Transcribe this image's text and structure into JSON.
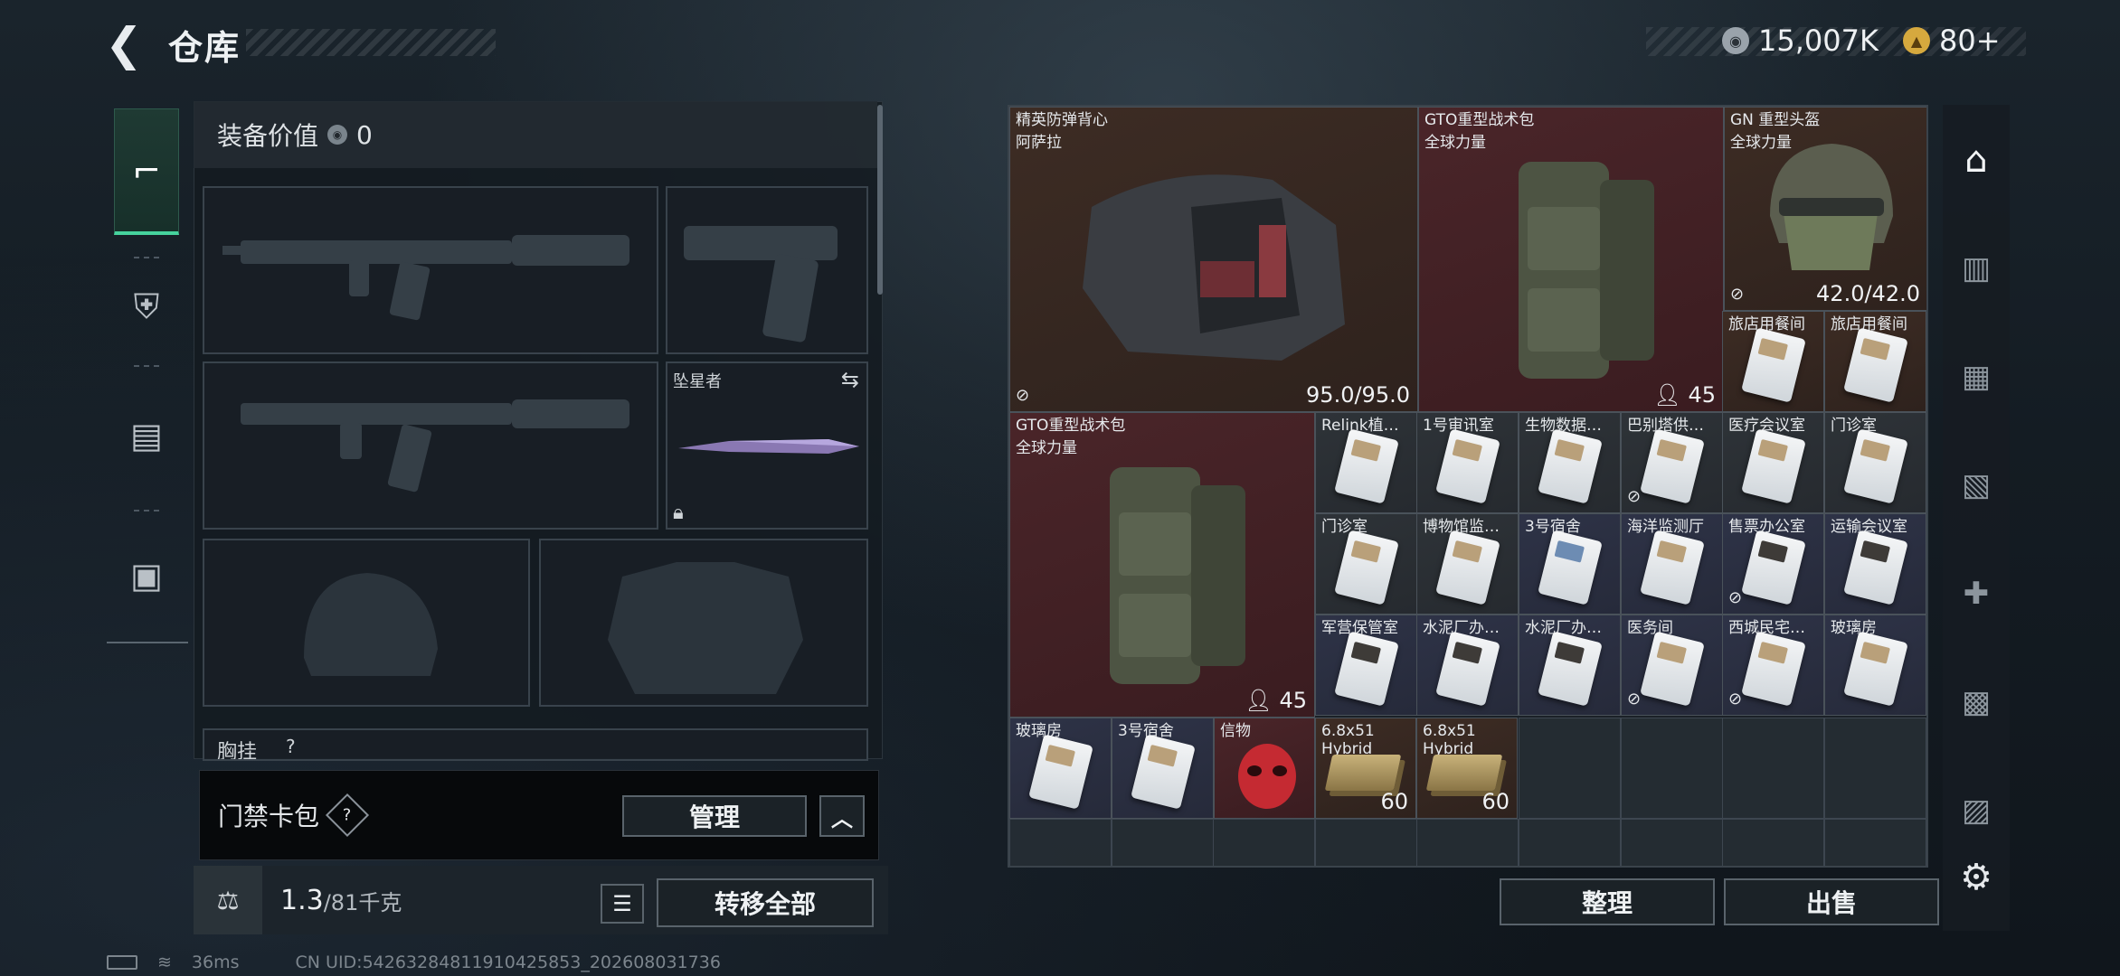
{
  "header": {
    "title": "仓库",
    "currency1": "15,007K",
    "currency2": "80+"
  },
  "left_tabs": [
    {
      "name": "weapon"
    },
    {
      "name": "armor"
    },
    {
      "name": "backpack"
    },
    {
      "name": "toolbox"
    }
  ],
  "equipment": {
    "value_label": "装备价值",
    "value": "0",
    "melee_name": "坠星者",
    "chest_label": "胸挂",
    "chest_hint": "?"
  },
  "card_bag": {
    "label": "门禁卡包",
    "help": "?",
    "manage": "管理"
  },
  "weight": {
    "current": "1.3",
    "max": "/81千克",
    "transfer_all": "转移全部"
  },
  "inventory": {
    "vest": {
      "name": "精英防弹背心",
      "sub": "阿萨拉",
      "value": "95.0/95.0"
    },
    "bag1": {
      "name": "GTO重型战术包",
      "sub": "全球力量",
      "value": "45"
    },
    "helmet": {
      "name": "GN 重型头盔",
      "sub": "全球力量",
      "value": "42.0/42.0"
    },
    "bag2": {
      "name": "GTO重型战术包",
      "sub": "全球力量",
      "value": "45"
    },
    "cards": [
      "旅店用餐间",
      "旅店用餐间",
      "Relink植…",
      "1号审讯室",
      "生物数据…",
      "巴别塔供…",
      "医疗会议室",
      "门诊室",
      "门诊室",
      "博物馆监…",
      "3号宿舍",
      "海洋监测厅",
      "售票办公室",
      "运输会议室",
      "军营保管室",
      "水泥厂办…",
      "水泥厂办…",
      "医务间",
      "西城民宅…",
      "玻璃房",
      "玻璃房",
      "3号宿舍"
    ],
    "token": {
      "name": "信物"
    },
    "ammo1": {
      "name": "6.8x51 Hybrid",
      "value": "60"
    },
    "ammo2": {
      "name": "6.8x51 Hybrid",
      "value": "60"
    }
  },
  "actions": {
    "sort": "整理",
    "sell": "出售"
  },
  "footer": {
    "ping": "36ms",
    "uid": "CN UID:54263284811910425853_202608031736"
  }
}
